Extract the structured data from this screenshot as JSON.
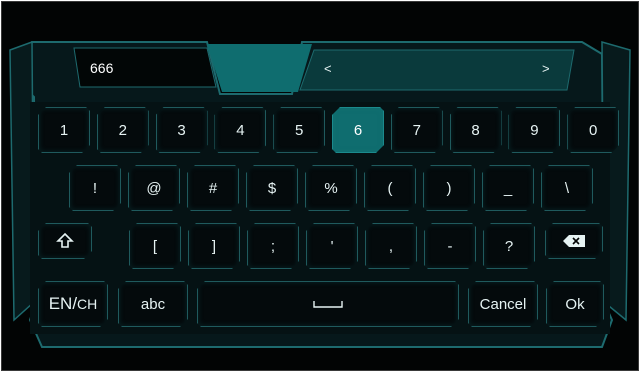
{
  "input": {
    "value": "666"
  },
  "candidates": {
    "prev": "<",
    "next": ">"
  },
  "rows": {
    "numbers": [
      "1",
      "2",
      "3",
      "4",
      "5",
      "6",
      "7",
      "8",
      "9",
      "0"
    ],
    "symbols1": [
      "!",
      "@",
      "#",
      "$",
      "%",
      "(",
      ")",
      "_",
      "\\"
    ],
    "symbols2": [
      "[",
      "]",
      ";",
      "'",
      ",",
      "-",
      "?"
    ]
  },
  "active_key": "6",
  "bottom": {
    "lang_en": "EN/",
    "lang_ch": "CH",
    "abc": "abc",
    "cancel": "Cancel",
    "ok": "Ok"
  },
  "icons": {
    "shift": "shift-icon",
    "backspace": "backspace-icon",
    "space": "space-icon"
  },
  "colors": {
    "accent": "#0f6d6f",
    "border": "#1f5a5d",
    "background": "#020404"
  }
}
